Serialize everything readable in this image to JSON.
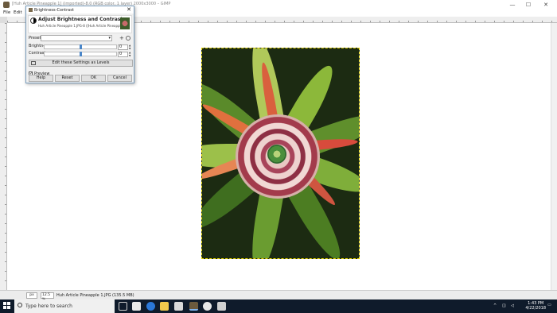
{
  "window": {
    "title": "[Huh Article Pineapple 1] (imported)-8.0 (RGB color, 1 layer) 2000x3000 – GIMP",
    "minimize": "—",
    "maximize": "☐",
    "close": "✕"
  },
  "menu": [
    "File",
    "Edit",
    "Select",
    "View",
    "Image",
    "Layer",
    "Colors",
    "Tools",
    "Filters",
    "Windows",
    "Help"
  ],
  "dialog": {
    "title": "Brightness-Contrast",
    "close": "✕",
    "heading": "Adjust Brightness and Contrast",
    "subtitle": "Huh Article Pineapple 1.JPG-8 ([Huh Article Pineapple 1] (importe…",
    "presets_label": "Presets:",
    "presets_value": "",
    "brightness_label": "Brightness:",
    "brightness_value": "0",
    "contrast_label": "Contrast:",
    "contrast_value": "0",
    "levels_button": "Edit these Settings as Levels",
    "preview_label": "Preview",
    "preview_checked": "✓",
    "buttons": {
      "help": "Help",
      "reset": "Reset",
      "ok": "OK",
      "cancel": "Cancel"
    }
  },
  "status": {
    "unit": "px",
    "zoom": "12.5 %",
    "info": "Huh Article Pineapple 1.JPG (135.5 MB)"
  },
  "taskbar": {
    "search_placeholder": "Type here to search",
    "time": "1:43 PM",
    "date": "4/22/2018"
  },
  "colors": {
    "accent": "#4a86c8",
    "taskbar": "#0f1b2b",
    "selection_border": "#e5d300"
  }
}
